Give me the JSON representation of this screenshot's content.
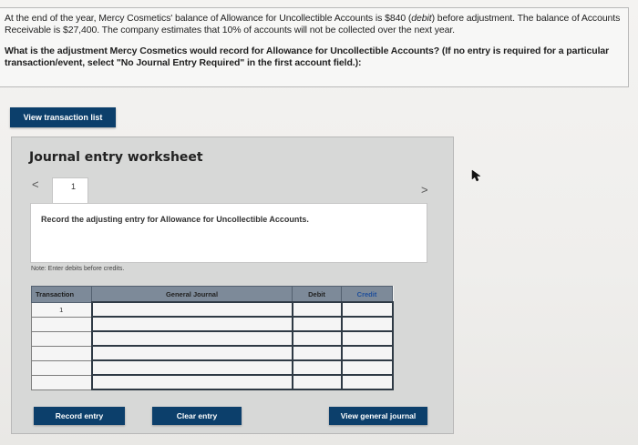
{
  "question": {
    "line1_pre": "At the end of the year, Mercy Cosmetics' balance of Allowance for Uncollectible Accounts is $840 (",
    "line1_em": "debit",
    "line1_post": ") before adjustment. The balance of Accounts Receivable is $27,400. The company estimates that 10% of accounts will not be collected over the next year.",
    "prompt_plain": "What is the adjustment Mercy Cosmetics would record for Allowance for Uncollectible Accounts? ",
    "prompt_bold": "(If no entry is required for a particular transaction/event, select \"No Journal Entry Required\" in the first account field.):"
  },
  "buttons": {
    "view_transaction_list": "View transaction list",
    "record_entry": "Record entry",
    "clear_entry": "Clear entry",
    "view_general_journal": "View general journal"
  },
  "worksheet": {
    "title": "Journal entry worksheet",
    "prev_symbol": "<",
    "next_symbol": ">",
    "current_tab": "1",
    "instruction": "Record the adjusting entry for Allowance for Uncollectible Accounts.",
    "note": "Note: Enter debits before credits."
  },
  "journal_table": {
    "headers": {
      "transaction": "Transaction",
      "general_journal": "General Journal",
      "debit": "Debit",
      "credit": "Credit"
    },
    "rows": [
      {
        "transaction": "1",
        "account": "",
        "debit": "",
        "credit": ""
      },
      {
        "transaction": "",
        "account": "",
        "debit": "",
        "credit": ""
      },
      {
        "transaction": "",
        "account": "",
        "debit": "",
        "credit": ""
      },
      {
        "transaction": "",
        "account": "",
        "debit": "",
        "credit": ""
      },
      {
        "transaction": "",
        "account": "",
        "debit": "",
        "credit": ""
      },
      {
        "transaction": "",
        "account": "",
        "debit": "",
        "credit": ""
      }
    ]
  },
  "colors": {
    "button_bg": "#0c3f6b",
    "table_header_bg": "#7d8a99",
    "worksheet_bg": "#d7d8d7"
  },
  "icons": {
    "cursor": "mouse-pointer-icon"
  }
}
